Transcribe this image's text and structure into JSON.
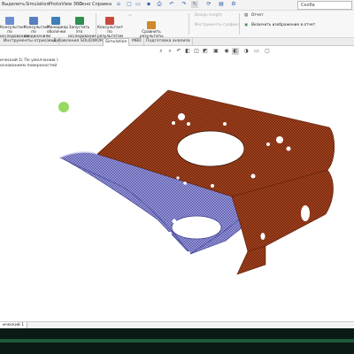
{
  "menu": {
    "items": [
      "Выделить",
      "Simulation",
      "PhotoView 360",
      "Окно",
      "Справка"
    ],
    "search_label": "Скоба"
  },
  "ribbon": {
    "buttons": [
      {
        "label": "Консультант по\nисследованию"
      },
      {
        "label": "Консультант по\nсоединениям"
      },
      {
        "label": "Менеджер\nоболочки"
      },
      {
        "label": "Запустить это\nисследование"
      },
      {
        "label": "Консультант по\nрезультатам"
      },
      {
        "label": "Сравнить\nрезультаты"
      }
    ],
    "disabled_items": [
      "Design Insight",
      "Инструменты графика"
    ],
    "report_label": "Отчет",
    "include_image_label": "Включить изображение в отчет"
  },
  "tabs": [
    {
      "label": "Инструменты отрисовки",
      "active": false
    },
    {
      "label": "Добавления SOLIDWORKS",
      "active": false
    },
    {
      "label": "Simulation",
      "active": true
    },
    {
      "label": "MBD",
      "active": false
    },
    {
      "label": "Подготовка анализа",
      "active": false
    }
  ],
  "tree": {
    "line1": "ический 1( По умолчанию )",
    "line2": "основанием поверхностей"
  },
  "status": {
    "tab_label": "ический 1"
  },
  "colors": {
    "mesh_outer": "#a3421d",
    "mesh_inner": "#8f8fd6",
    "accent_green": "#7ccf3c",
    "taskbar": "#0b1a14"
  }
}
